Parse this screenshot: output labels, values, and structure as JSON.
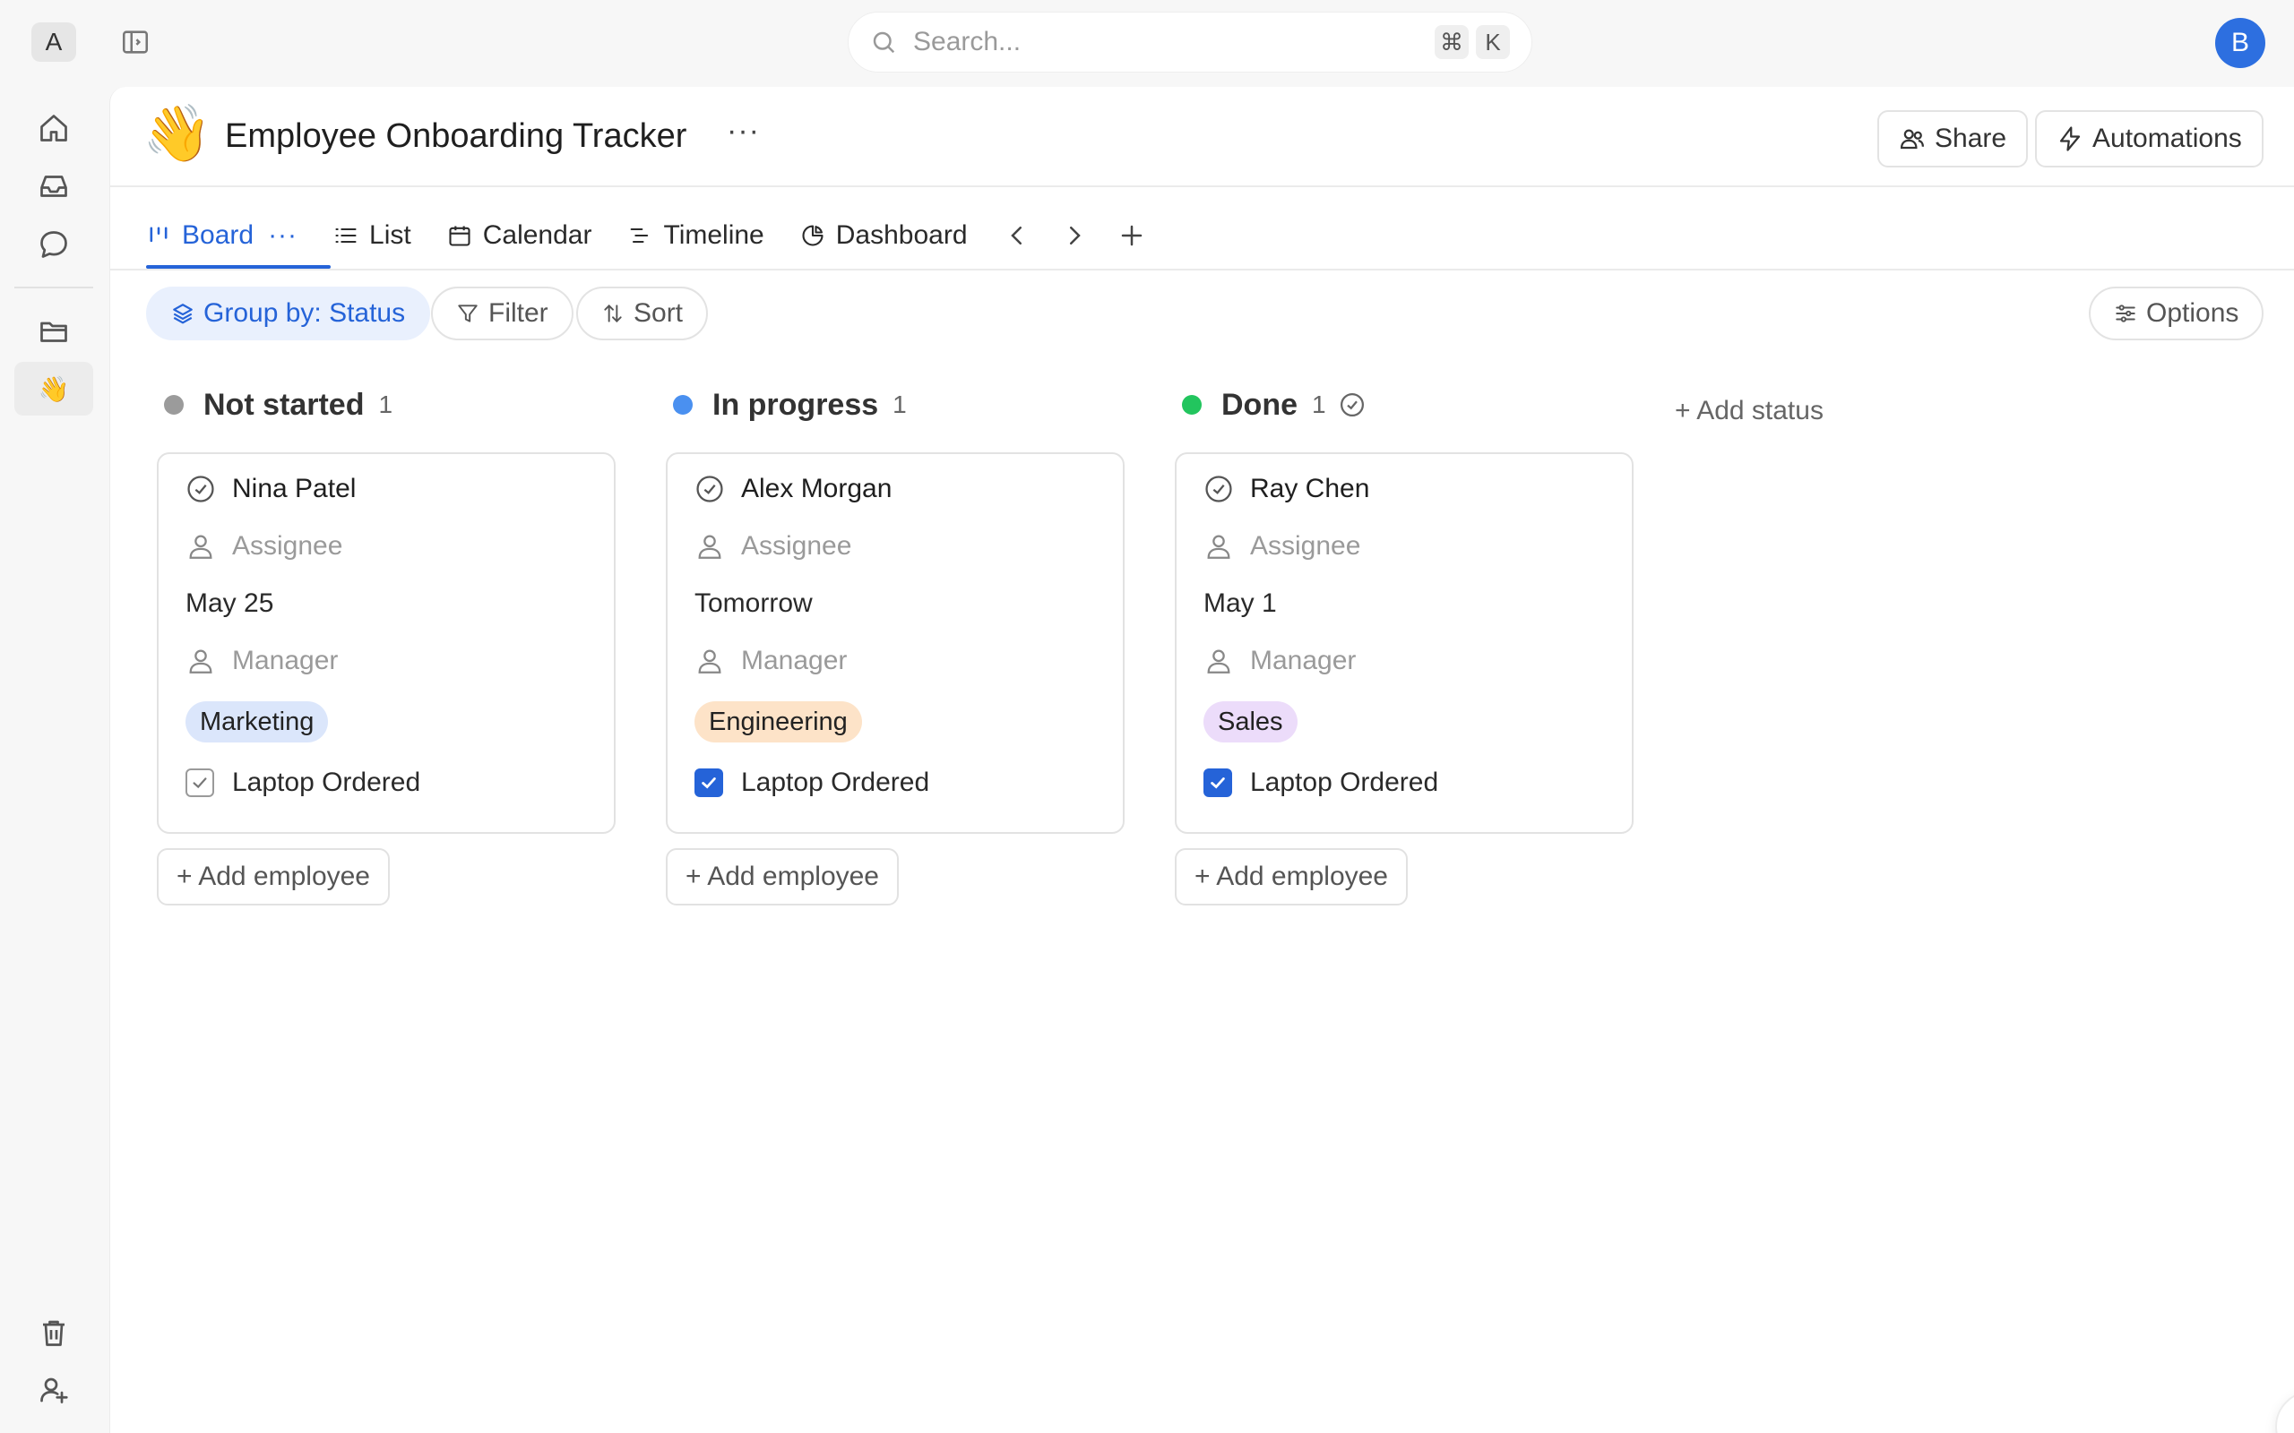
{
  "workspace": {
    "initial": "A"
  },
  "search": {
    "placeholder": "Search...",
    "shortcut_cmd": "⌘",
    "shortcut_key": "K"
  },
  "user": {
    "initial": "B"
  },
  "sidebar": {
    "icons": [
      "home-icon",
      "inbox-icon",
      "chat-icon",
      "folder-icon",
      "trash-icon",
      "add-user-icon"
    ],
    "active_emoji": "👋"
  },
  "page": {
    "emoji": "👋",
    "title": "Employee Onboarding Tracker",
    "more": "···",
    "share_label": "Share",
    "automations_label": "Automations"
  },
  "tabs": [
    {
      "label": "Board",
      "icon": "board-icon",
      "active": true
    },
    {
      "label": "List",
      "icon": "list-icon"
    },
    {
      "label": "Calendar",
      "icon": "calendar-icon"
    },
    {
      "label": "Timeline",
      "icon": "timeline-icon"
    },
    {
      "label": "Dashboard",
      "icon": "dashboard-icon"
    }
  ],
  "tab_more": "···",
  "toolbar": {
    "group_by": "Group by: Status",
    "filter": "Filter",
    "sort": "Sort",
    "options": "Options"
  },
  "columns": [
    {
      "name": "Not started",
      "count": "1",
      "color": "#9b9b9b",
      "card": {
        "name": "Nina Patel",
        "assignee": "Assignee",
        "date": "May 25",
        "manager": "Manager",
        "department": "Marketing",
        "tag_color": "#dbe6fb",
        "laptop_label": "Laptop Ordered",
        "laptop_checked": false
      },
      "add_label": "+ Add employee"
    },
    {
      "name": "In progress",
      "count": "1",
      "color": "#4a90f0",
      "card": {
        "name": "Alex Morgan",
        "assignee": "Assignee",
        "date": "Tomorrow",
        "manager": "Manager",
        "department": "Engineering",
        "tag_color": "#fde3c8",
        "laptop_label": "Laptop Ordered",
        "laptop_checked": true
      },
      "add_label": "+ Add employee"
    },
    {
      "name": "Done",
      "count": "1",
      "color": "#22c55e",
      "card": {
        "name": "Ray Chen",
        "assignee": "Assignee",
        "date": "May 1",
        "manager": "Manager",
        "department": "Sales",
        "tag_color": "#ecdcfa",
        "laptop_label": "Laptop Ordered",
        "laptop_checked": true
      },
      "add_label": "+ Add employee"
    }
  ],
  "add_status": "+ Add status",
  "colors": {
    "accent": "#2563d8"
  }
}
